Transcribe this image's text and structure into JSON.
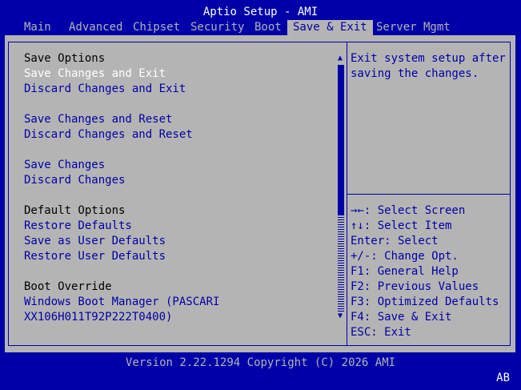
{
  "title": "Aptio Setup - AMI",
  "tabs": [
    "Main",
    "Advanced",
    "Chipset",
    "Security",
    "Boot",
    "Save & Exit",
    "Server Mgmt"
  ],
  "active_tab": "Save & Exit",
  "menu": {
    "save_options_header": "Save Options",
    "save_changes_and_exit": "Save Changes and Exit",
    "discard_changes_and_exit": "Discard Changes and Exit",
    "save_changes_and_reset": "Save Changes and Reset",
    "discard_changes_and_reset": "Discard Changes and Reset",
    "save_changes": "Save Changes",
    "discard_changes": "Discard Changes",
    "default_options_header": "Default Options",
    "restore_defaults": "Restore Defaults",
    "save_as_user_defaults": "Save as User Defaults",
    "restore_user_defaults": "Restore User Defaults",
    "boot_override_header": "Boot Override",
    "boot_entry_line1": "Windows Boot Manager (PASCARI",
    "boot_entry_line2": "XX106H011T92P222T0400)"
  },
  "selected_item": "Save Changes and Exit",
  "help": {
    "line1": "Exit system setup after",
    "line2": "saving the changes."
  },
  "keys": {
    "select_screen": "→←: Select Screen",
    "select_item": "↑↓: Select Item",
    "enter": "Enter: Select",
    "change_opt": "+/-: Change Opt.",
    "f1": "F1: General Help",
    "f2": "F2: Previous Values",
    "f3": "F3: Optimized Defaults",
    "f4": "F4: Save & Exit",
    "esc": "ESC: Exit"
  },
  "scrollbar": {
    "up_icon": "up-arrow-icon",
    "down_icon": "down-arrow-icon"
  },
  "footer": "Version 2.22.1294 Copyright (C) 2026 AMI",
  "language": "AB",
  "colors": {
    "background_blue": "#0000a8",
    "panel_gray": "#b4b4b4",
    "selected_white": "#ffffff"
  }
}
